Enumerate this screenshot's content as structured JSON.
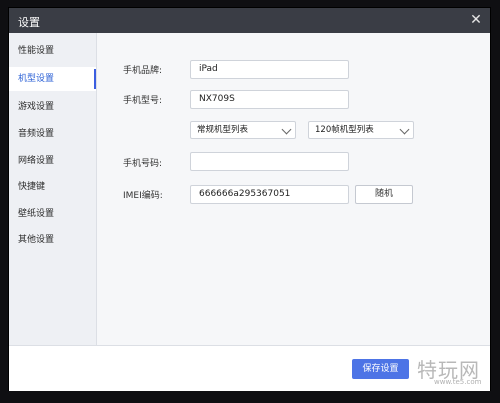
{
  "window": {
    "title": "设置",
    "close_icon": "close-icon"
  },
  "sidebar": {
    "items": [
      {
        "label": "性能设置"
      },
      {
        "label": "机型设置"
      },
      {
        "label": "游戏设置"
      },
      {
        "label": "音频设置"
      },
      {
        "label": "网络设置"
      },
      {
        "label": "快捷键"
      },
      {
        "label": "壁纸设置"
      },
      {
        "label": "其他设置"
      }
    ]
  },
  "main": {
    "brand_label": "手机品牌:",
    "brand_value": "iPad",
    "model_label": "手机型号:",
    "model_value": "NX709S",
    "select_common": "常规机型列表",
    "select_120": "120帧机型列表",
    "phone_label": "手机号码:",
    "phone_value": "",
    "imei_label": "IMEI编码:",
    "imei_value": "666666a295367051",
    "random_label": "随机"
  },
  "footer": {
    "save_label": "保存设置"
  },
  "watermark": {
    "text": "特玩网",
    "url": "www.te5.com"
  }
}
